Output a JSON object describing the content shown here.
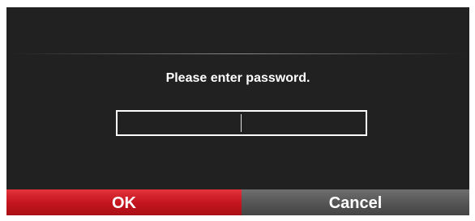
{
  "dialog": {
    "prompt": "Please enter password.",
    "password_value": "",
    "ok_label": "OK",
    "cancel_label": "Cancel",
    "colors": {
      "background": "#212121",
      "ok_button": "#c3141d",
      "cancel_button": "#545454",
      "text": "#ffffff"
    }
  }
}
